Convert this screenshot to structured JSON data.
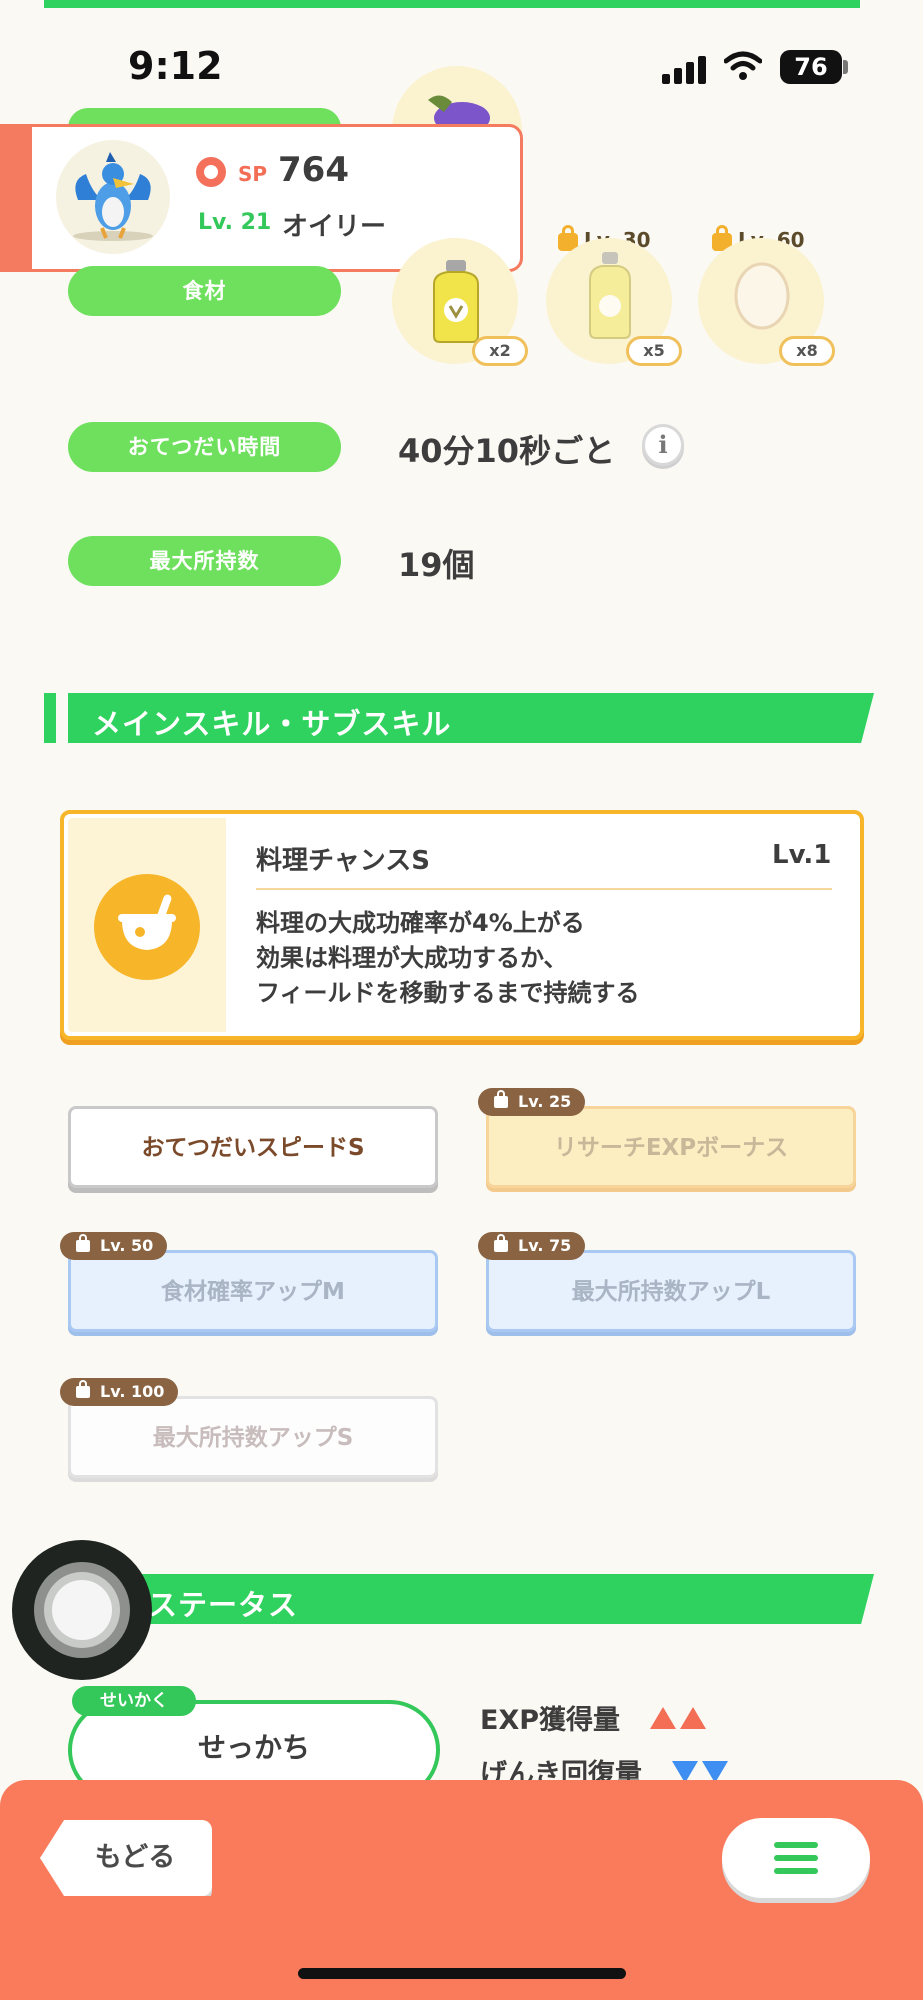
{
  "status_bar": {
    "time": "9:12",
    "battery": "76"
  },
  "profile": {
    "sp_label": "SP",
    "sp_value": "764",
    "level": "Lv. 21",
    "name": "オイリー"
  },
  "labels": {
    "ingredients": "食材",
    "help_time": "おてつだい時間",
    "max_carry": "最大所持数"
  },
  "help_time_value": "40分10秒ごと",
  "max_carry_value": "19個",
  "info_icon": "i",
  "ingredients": [
    {
      "icon": "oil-bottle-icon",
      "qty": "x2",
      "unlock": ""
    },
    {
      "icon": "oil-bottle-icon",
      "qty": "x5",
      "unlock": "Lv. 30"
    },
    {
      "icon": "egg-icon",
      "qty": "x8",
      "unlock": "Lv. 60"
    }
  ],
  "sections": {
    "skills": "メインスキル・サブスキル",
    "status": "ステータス"
  },
  "main_skill": {
    "title": "料理チャンスS",
    "level": "Lv.1",
    "desc_lines": [
      "料理の大成功確率が4%上がる",
      "効果は料理が大成功するか、",
      "フィールドを移動するまで持続する"
    ]
  },
  "sub_skills": [
    {
      "label": "おてつだいスピードS",
      "lock": ""
    },
    {
      "label": "リサーチEXPボーナス",
      "lock": "Lv. 25"
    },
    {
      "label": "食材確率アップM",
      "lock": "Lv. 50"
    },
    {
      "label": "最大所持数アップL",
      "lock": "Lv. 75"
    },
    {
      "label": "最大所持数アップS",
      "lock": "Lv. 100"
    }
  ],
  "nature": {
    "tag": "せいかく",
    "value": "せっかち"
  },
  "stats": [
    {
      "label": "EXP獲得量",
      "direction": "up",
      "count": 2
    },
    {
      "label": "げんき回復量",
      "direction": "down",
      "count": 2
    }
  ],
  "nav": {
    "back": "もどる"
  },
  "colors": {
    "green": "#2fd25f",
    "coral": "#fa7b5c",
    "gold": "#f7b52a"
  }
}
